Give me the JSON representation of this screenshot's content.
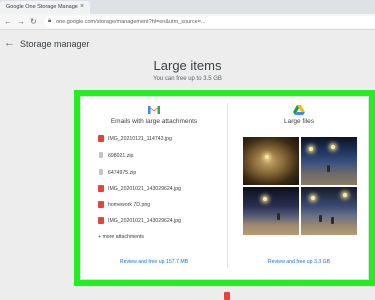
{
  "browser": {
    "tab_title": "Google One Storage Manage",
    "tab_close": "×",
    "address": "one.google.com/storage/management?hl=en&utm_source=...",
    "icons": {
      "back": "arrow-left-icon",
      "forward": "arrow-right-icon",
      "reload": "reload-icon",
      "lock": "lock-icon"
    }
  },
  "app": {
    "title": "Storage manager",
    "back_icon": "arrow-left-icon"
  },
  "page": {
    "title": "Large items",
    "subtitle": "You can free up to 3.5 GB"
  },
  "emails": {
    "title": "Emails with large attachments",
    "attachments": [
      {
        "name": "IMG_20210121_114743.jpg",
        "type": "pdf"
      },
      {
        "name": "698021.zip",
        "type": "zip"
      },
      {
        "name": "6474975.zip",
        "type": "zip"
      },
      {
        "name": "IMG_20201021_143029624.jpg",
        "type": "pdf"
      },
      {
        "name": "homework 7D.png",
        "type": "pdf"
      },
      {
        "name": "IMG_20201021_143029624.jpg",
        "type": "pdf"
      }
    ],
    "more_label": "+ more attachments",
    "review_label": "Review and free up 157.7 MB"
  },
  "files": {
    "title": "Large files",
    "review_label": "Review and free up 3.3 GB"
  },
  "colors": {
    "highlight": "#22ee22",
    "link": "#1a73e8",
    "pdf_icon": "#e8413a"
  }
}
